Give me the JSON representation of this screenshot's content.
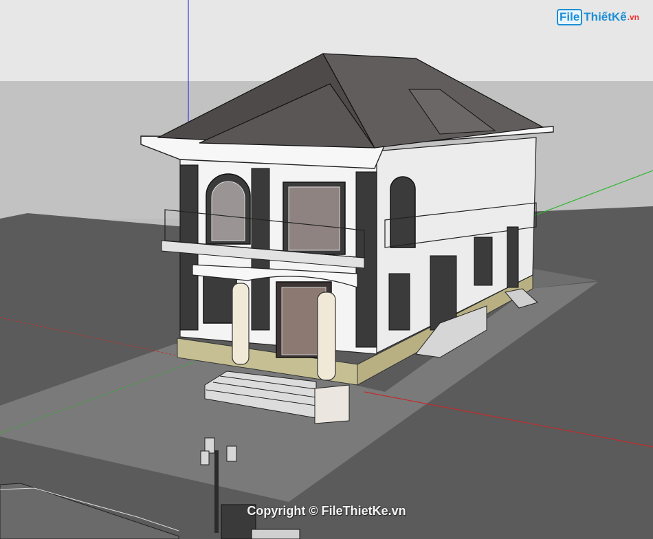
{
  "watermark": {
    "logo_file": "File",
    "logo_name": "ThiếtKế",
    "logo_tld": ".vn",
    "copyright": "Copyright © FileThietKe.vn"
  },
  "colors": {
    "sky": "#e7e7e7",
    "ground": "#5b5b5b",
    "lot": "#7a7a7a",
    "roof": "#5a5656",
    "wall": "#f4f4f4",
    "column": "#f0e9d8",
    "base": "#c6bf93",
    "axis_blue": "#3b3bd6",
    "axis_green": "#2bb52b",
    "axis_red": "#c42a2a",
    "brand": "#1c8fd6"
  }
}
